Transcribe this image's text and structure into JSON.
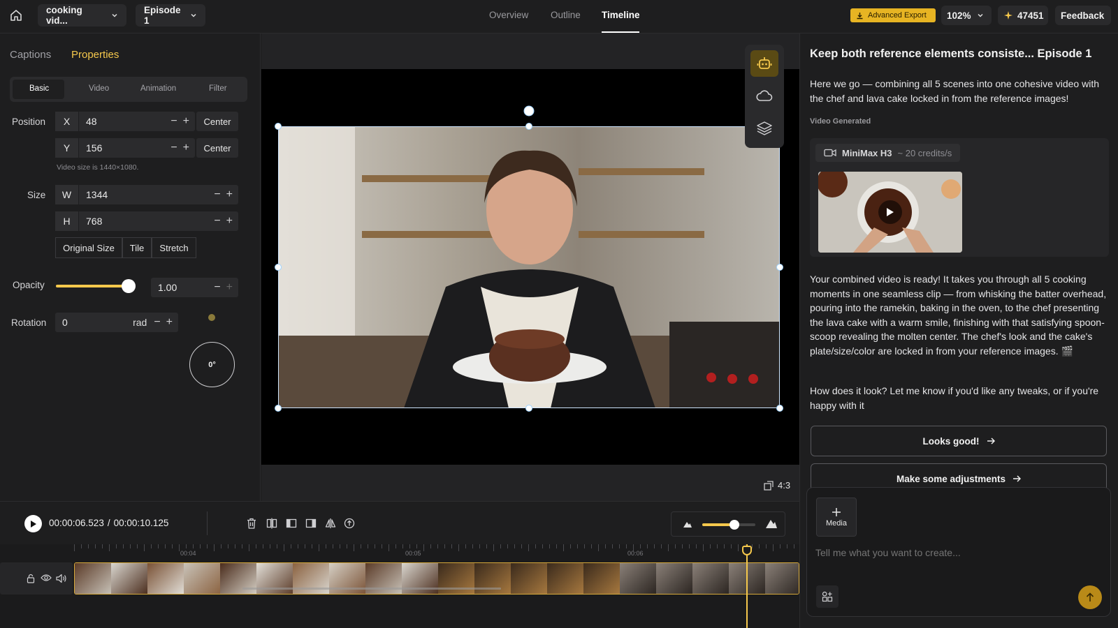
{
  "topbar": {
    "project_name": "cooking vid...",
    "episode": "Episode 1",
    "tabs": [
      {
        "label": "Overview",
        "active": false
      },
      {
        "label": "Outline",
        "active": false
      },
      {
        "label": "Timeline",
        "active": true
      }
    ],
    "export_label": "Advanced Export",
    "zoom": "102%",
    "credits": "47451",
    "feedback_label": "Feedback"
  },
  "left": {
    "tabs": [
      {
        "label": "Captions",
        "active": false
      },
      {
        "label": "Properties",
        "active": true
      }
    ],
    "subtabs": [
      {
        "label": "Basic",
        "active": true
      },
      {
        "label": "Video"
      },
      {
        "label": "Animation"
      },
      {
        "label": "Filter"
      }
    ],
    "position": {
      "label": "Position",
      "x_prefix": "X",
      "x": "48",
      "y_prefix": "Y",
      "y": "156",
      "center_label": "Center",
      "hint": "Video size is 1440×1080."
    },
    "size": {
      "label": "Size",
      "w_prefix": "W",
      "w": "1344",
      "h_prefix": "H",
      "h": "768",
      "buttons": [
        "Original Size",
        "Tile",
        "Stretch"
      ]
    },
    "opacity": {
      "label": "Opacity",
      "value": "1.00",
      "level": 1.0
    },
    "rotation": {
      "label": "Rotation",
      "value": "0",
      "unit": "rad",
      "dial": "0°"
    }
  },
  "canvas": {
    "aspect_label": "4:3"
  },
  "player": {
    "current_time": "00:00:06.523",
    "separator": "/",
    "total_time": "00:00:10.125",
    "zoom_level": 0.6
  },
  "timeline": {
    "labels": [
      "00:04",
      "00:05",
      "00:06"
    ]
  },
  "right": {
    "title": "Keep both reference elements consiste... Episode 1",
    "intro": "Here we go — combining all 5 scenes into one cohesive video with the chef and lava cake locked in from the reference images!",
    "section_label": "Video Generated",
    "model": {
      "name": "MiniMax H3",
      "cost": "~ 20 credits/s"
    },
    "description": "Your combined video is ready! It takes you through all 5 cooking moments in one seamless clip — from whisking the batter overhead, pouring into the ramekin, baking in the oven, to the chef presenting the lava cake with a warm smile, finishing with that satisfying spoon-scoop revealing the molten center. The chef's look and the cake's plate/size/color are locked in from your reference images. 🎬",
    "question": "How does it look? Let me know if you'd like any tweaks, or if you're happy with it",
    "buttons": [
      {
        "label": "Looks good!"
      },
      {
        "label": "Make some adjustments"
      }
    ],
    "chat": {
      "media_label": "Media",
      "placeholder": "Tell me what you want to create..."
    }
  },
  "colors": {
    "accent": "#f5c84c",
    "background": "#1b1b1c",
    "panel": "#1e1e1f"
  }
}
